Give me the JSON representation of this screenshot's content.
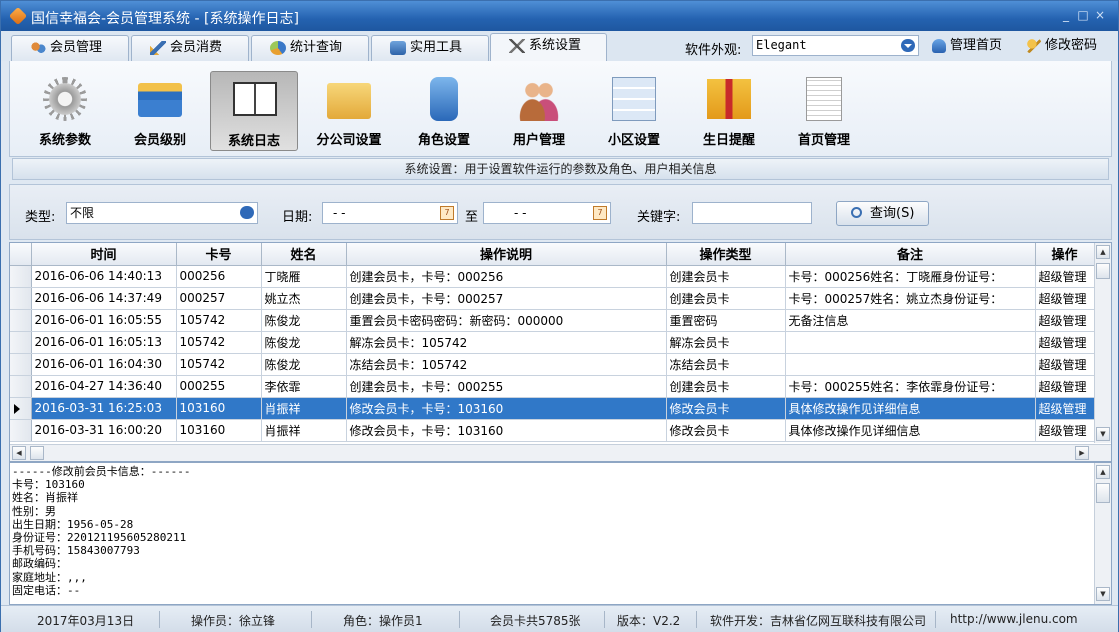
{
  "window": {
    "title": "国信幸福会-会员管理系统 - [系统操作日志]",
    "controls": [
      "_",
      "□",
      "×"
    ]
  },
  "tabs": [
    {
      "label": "会员管理",
      "icon": "members-icon",
      "active": false
    },
    {
      "label": "会员消费",
      "icon": "consume-icon",
      "active": false
    },
    {
      "label": "统计查询",
      "icon": "stats-icon",
      "active": false
    },
    {
      "label": "实用工具",
      "icon": "tools-icon",
      "active": false
    },
    {
      "label": "系统设置",
      "icon": "settings-icon",
      "active": true
    }
  ],
  "header": {
    "skin_label": "软件外观:",
    "skin_value": "Elegant",
    "home_label": "管理首页",
    "password_label": "修改密码"
  },
  "ribbon": [
    {
      "label": "系统参数",
      "icon": "gear-icon",
      "active": false
    },
    {
      "label": "会员级别",
      "icon": "cards-icon",
      "active": false
    },
    {
      "label": "系统日志",
      "icon": "book-icon",
      "active": true
    },
    {
      "label": "分公司设置",
      "icon": "folders-icon",
      "active": false
    },
    {
      "label": "角色设置",
      "icon": "role-icon",
      "active": false
    },
    {
      "label": "用户管理",
      "icon": "users-icon",
      "active": false
    },
    {
      "label": "小区设置",
      "icon": "grid-window-icon",
      "active": false
    },
    {
      "label": "生日提醒",
      "icon": "gift-icon",
      "active": false
    },
    {
      "label": "首页管理",
      "icon": "document-icon",
      "active": false
    }
  ],
  "description": "系统设置：用于设置软件运行的参数及角色、用户相关信息",
  "filter": {
    "type_label": "类型:",
    "type_value": "不限",
    "date_label": "日期:",
    "date_from": "-  -",
    "to_label": "至",
    "date_to": "-  -",
    "keyword_label": "关键字:",
    "keyword_value": "",
    "query_label": "查询(S)"
  },
  "table": {
    "columns": [
      "时间",
      "卡号",
      "姓名",
      "操作说明",
      "操作类型",
      "备注",
      "操作"
    ],
    "rows": [
      [
        "2016-06-06 14:40:13",
        "000256",
        "丁晓雁",
        "创建会员卡，卡号：000256",
        "创建会员卡",
        "卡号：000256姓名：丁晓雁身份证号：",
        "超级管理"
      ],
      [
        "2016-06-06 14:37:49",
        "000257",
        "姚立杰",
        "创建会员卡，卡号：000257",
        "创建会员卡",
        "卡号：000257姓名：姚立杰身份证号：",
        "超级管理"
      ],
      [
        "2016-06-01 16:05:55",
        "105742",
        "陈俊龙",
        "重置会员卡密码密码：新密码：000000",
        "重置密码",
        "无备注信息",
        "超级管理"
      ],
      [
        "2016-06-01 16:05:13",
        "105742",
        "陈俊龙",
        "解冻会员卡：105742",
        "解冻会员卡",
        "",
        "超级管理"
      ],
      [
        "2016-06-01 16:04:30",
        "105742",
        "陈俊龙",
        "冻结会员卡：105742",
        "冻结会员卡",
        "",
        "超级管理"
      ],
      [
        "2016-04-27 14:36:40",
        "000255",
        "李依霏",
        "创建会员卡，卡号：000255",
        "创建会员卡",
        "卡号：000255姓名：李依霏身份证号：",
        "超级管理"
      ],
      [
        "2016-03-31 16:25:03",
        "103160",
        "肖振祥",
        "修改会员卡，卡号：103160",
        "修改会员卡",
        "具体修改操作见详细信息",
        "超级管理"
      ],
      [
        "2016-03-31 16:00:20",
        "103160",
        "肖振祥",
        "修改会员卡，卡号：103160",
        "修改会员卡",
        "具体修改操作见详细信息",
        "超级管理"
      ]
    ],
    "selected_index": 6
  },
  "detail_lines": [
    "------修改前会员卡信息：------",
    "卡号：103160",
    "姓名：肖振祥",
    "性别：男",
    "出生日期：1956-05-28",
    "身份证号：220121195605280211",
    "手机号码：15843007793",
    "邮政编码：",
    "家庭地址：,,,",
    "固定电话：--"
  ],
  "status": [
    "2017年03月13日",
    "操作员：徐立锋",
    "角色：操作员1",
    "会员卡共5785张",
    "版本：V2.2",
    "软件开发：吉林省亿网互联科技有限公司",
    "http://www.jlenu.com"
  ]
}
